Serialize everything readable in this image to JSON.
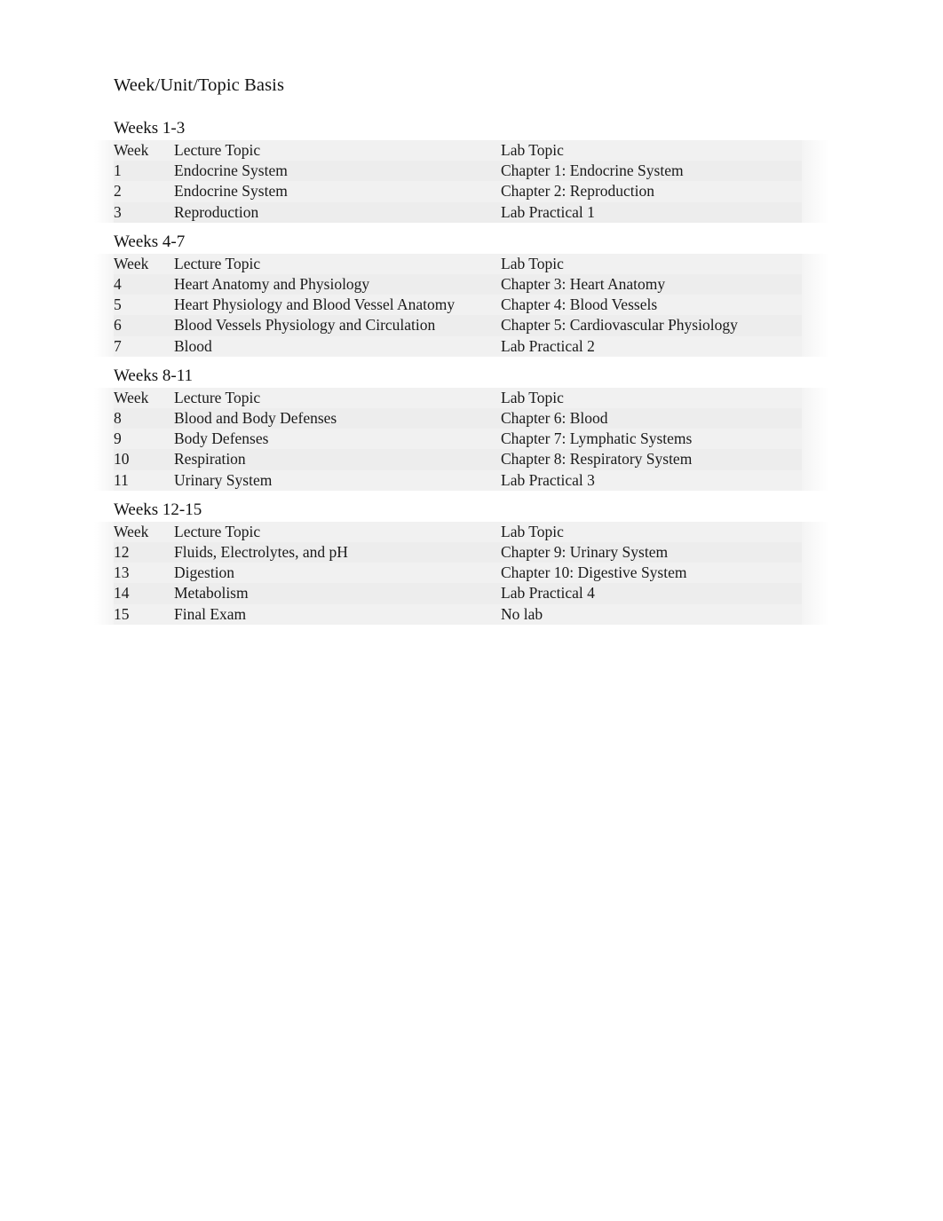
{
  "document": {
    "title": "Week/Unit/Topic Basis"
  },
  "columns": {
    "week": "Week",
    "lecture": "Lecture Topic",
    "lab": "Lab Topic"
  },
  "blocks": [
    {
      "heading": "Weeks 1-3",
      "rows": [
        {
          "week": "1",
          "lecture": "Endocrine System",
          "lab": "Chapter 1: Endocrine System"
        },
        {
          "week": "2",
          "lecture": "Endocrine System",
          "lab": "Chapter 2: Reproduction"
        },
        {
          "week": "3",
          "lecture": "Reproduction",
          "lab": "Lab Practical 1"
        }
      ]
    },
    {
      "heading": "Weeks 4-7",
      "rows": [
        {
          "week": "4",
          "lecture": "Heart Anatomy and Physiology",
          "lab": "Chapter 3: Heart Anatomy"
        },
        {
          "week": "5",
          "lecture": "Heart Physiology and Blood Vessel Anatomy",
          "lab": "Chapter 4: Blood Vessels"
        },
        {
          "week": "6",
          "lecture": "Blood Vessels Physiology and Circulation",
          "lab": "Chapter 5: Cardiovascular Physiology"
        },
        {
          "week": "7",
          "lecture": "Blood",
          "lab": "Lab Practical 2"
        }
      ]
    },
    {
      "heading": "Weeks 8-11",
      "rows": [
        {
          "week": "8",
          "lecture": "Blood and Body Defenses",
          "lab": "Chapter 6: Blood"
        },
        {
          "week": "9",
          "lecture": "Body Defenses",
          "lab": "Chapter 7: Lymphatic Systems"
        },
        {
          "week": "10",
          "lecture": "Respiration",
          "lab": "Chapter 8: Respiratory System"
        },
        {
          "week": "11",
          "lecture": "Urinary System",
          "lab": "Lab Practical 3"
        }
      ]
    },
    {
      "heading": "Weeks 12-15",
      "rows": [
        {
          "week": "12",
          "lecture": "Fluids, Electrolytes, and pH",
          "lab": "Chapter 9: Urinary System"
        },
        {
          "week": "13",
          "lecture": "Digestion",
          "lab": "Chapter 10: Digestive System"
        },
        {
          "week": "14",
          "lecture": "Metabolism",
          "lab": "Lab Practical 4"
        },
        {
          "week": "15",
          "lecture": "Final Exam",
          "lab": "No lab"
        }
      ]
    }
  ],
  "colors": {
    "page_background": "#ffffff",
    "text": "#1a1a1a",
    "row_shade_light": "#f1f1f1",
    "row_shade_alt": "#ededed"
  }
}
